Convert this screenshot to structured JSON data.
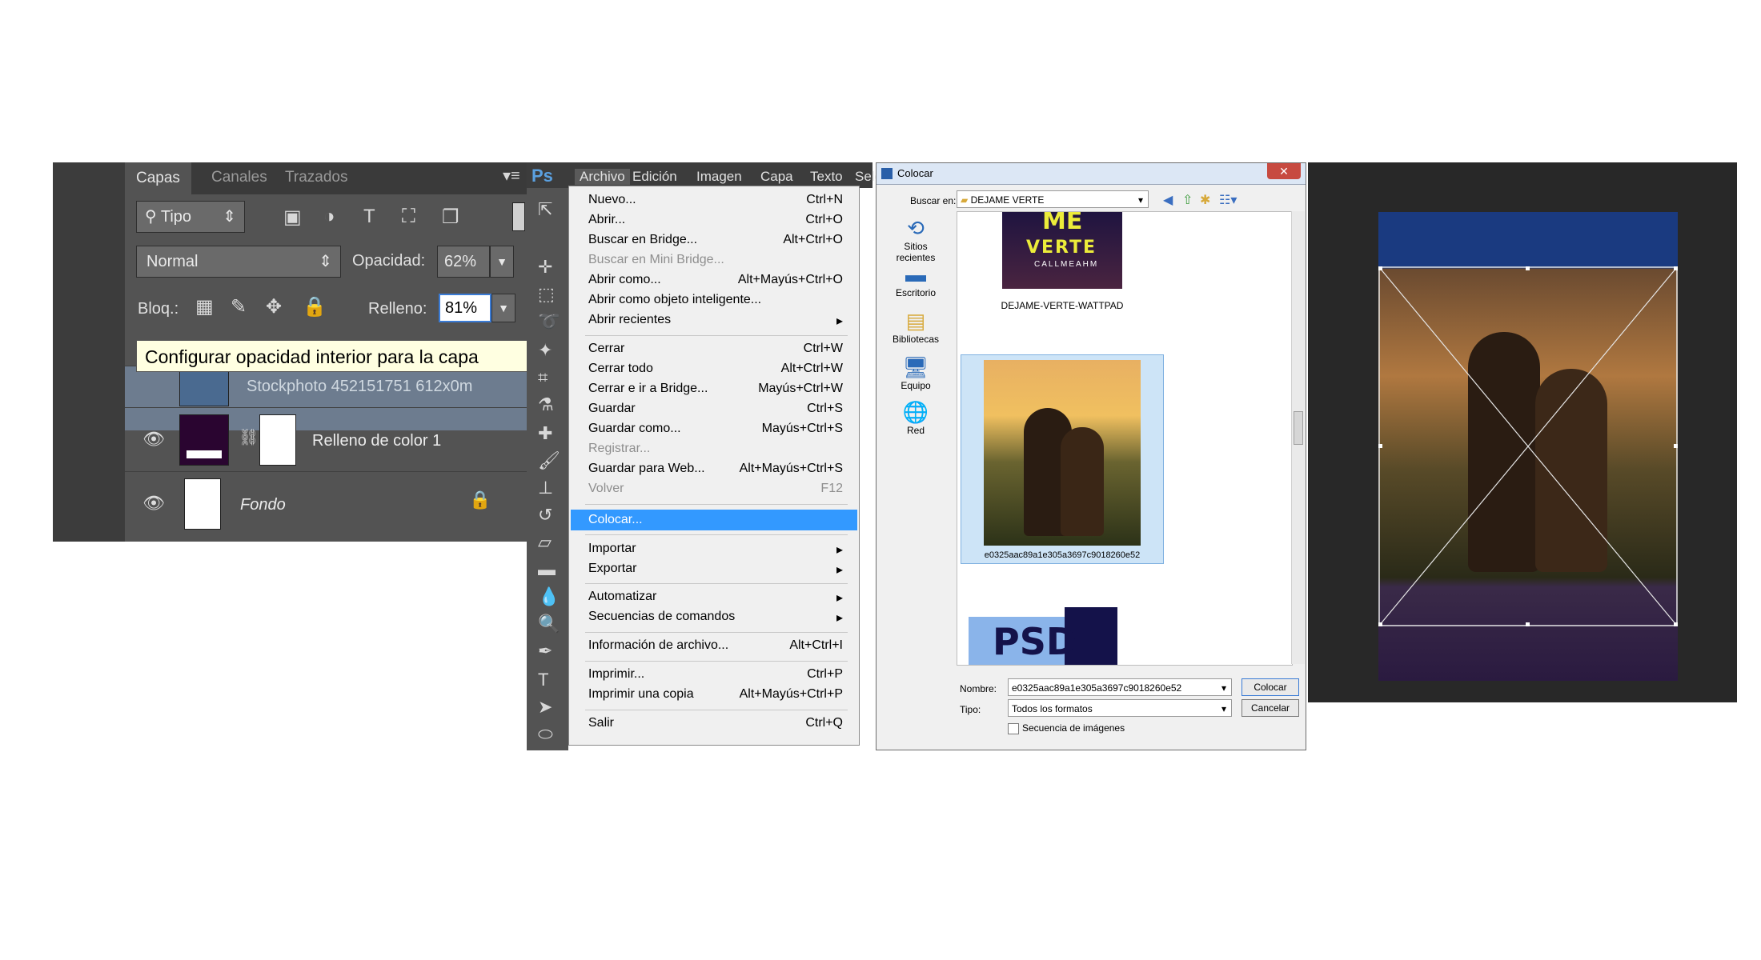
{
  "layers_panel": {
    "tabs": [
      "Capas",
      "Canales",
      "Trazados"
    ],
    "filter_kind": "Tipo",
    "blend_mode": "Normal",
    "opacity_label": "Opacidad:",
    "opacity_value": "62%",
    "lock_label": "Bloq.:",
    "fill_label": "Relleno:",
    "fill_value": "81%",
    "tooltip": "Configurar opacidad interior para la capa",
    "layers": [
      {
        "name": "Stockphoto 452151751 612x0m"
      },
      {
        "name": "Relleno de color 1",
        "color": "#2a0530"
      },
      {
        "name": "Fondo"
      }
    ]
  },
  "menubar": {
    "logo": "Ps",
    "items": [
      "Archivo",
      "Edición",
      "Imagen",
      "Capa",
      "Texto",
      "Sele"
    ]
  },
  "file_menu": {
    "items": [
      {
        "label": "Nuevo...",
        "shortcut": "Ctrl+N"
      },
      {
        "label": "Abrir...",
        "shortcut": "Ctrl+O"
      },
      {
        "label": "Buscar en Bridge...",
        "shortcut": "Alt+Ctrl+O"
      },
      {
        "label": "Buscar en Mini Bridge...",
        "shortcut": ""
      },
      {
        "label": "Abrir como...",
        "shortcut": "Alt+Mayús+Ctrl+O"
      },
      {
        "label": "Abrir como objeto inteligente...",
        "shortcut": ""
      },
      {
        "label": "Abrir recientes",
        "shortcut": "▸"
      },
      {
        "label": "Cerrar",
        "shortcut": "Ctrl+W"
      },
      {
        "label": "Cerrar todo",
        "shortcut": "Alt+Ctrl+W"
      },
      {
        "label": "Cerrar e ir a Bridge...",
        "shortcut": "Mayús+Ctrl+W"
      },
      {
        "label": "Guardar",
        "shortcut": "Ctrl+S"
      },
      {
        "label": "Guardar como...",
        "shortcut": "Mayús+Ctrl+S"
      },
      {
        "label": "Registrar...",
        "shortcut": ""
      },
      {
        "label": "Guardar para Web...",
        "shortcut": "Alt+Mayús+Ctrl+S"
      },
      {
        "label": "Volver",
        "shortcut": "F12"
      },
      {
        "label": "Colocar...",
        "shortcut": ""
      },
      {
        "label": "Importar",
        "shortcut": "▸"
      },
      {
        "label": "Exportar",
        "shortcut": "▸"
      },
      {
        "label": "Automatizar",
        "shortcut": "▸"
      },
      {
        "label": "Secuencias de comandos",
        "shortcut": "▸"
      },
      {
        "label": "Información de archivo...",
        "shortcut": "Alt+Ctrl+I"
      },
      {
        "label": "Imprimir...",
        "shortcut": "Ctrl+P"
      },
      {
        "label": "Imprimir una copia",
        "shortcut": "Alt+Mayús+Ctrl+P"
      },
      {
        "label": "Salir",
        "shortcut": "Ctrl+Q"
      }
    ]
  },
  "place_dialog": {
    "title": "Colocar",
    "close": "✕",
    "look_in_label": "Buscar en:",
    "look_in_value": "DEJAME VERTE",
    "places": [
      "Sitios recientes",
      "Escritorio",
      "Bibliotecas",
      "Equipo",
      "Red"
    ],
    "files": [
      {
        "name": "DEJAME-VERTE-WATTPAD",
        "thumb_text_1": "ME",
        "thumb_text_2": "VERTE",
        "thumb_text_3": "CALLMEAHM"
      },
      {
        "name": "e0325aac89a1e305a3697c9018260e52"
      },
      {
        "name": "",
        "thumb_text": "PSD"
      }
    ],
    "filename_label": "Nombre:",
    "filename_value": "e0325aac89a1e305a3697c9018260e52",
    "type_label": "Tipo:",
    "type_value": "Todos los formatos",
    "sequence_label": "Secuencia de imágenes",
    "ok_button": "Colocar",
    "cancel_button": "Cancelar"
  }
}
